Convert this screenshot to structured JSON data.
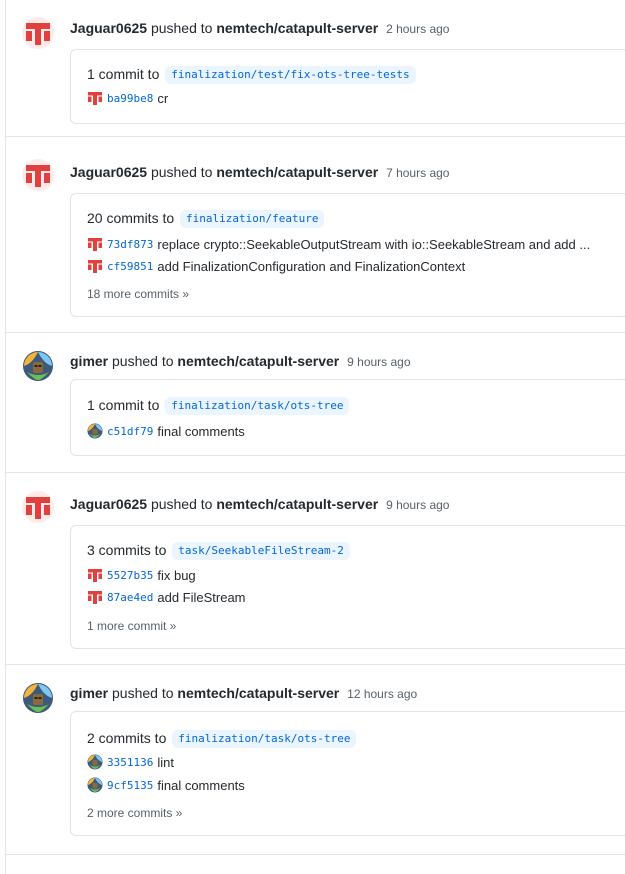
{
  "events": [
    {
      "actor": "Jaguar0625",
      "verb": "pushed to",
      "repo": "nemtech/catapult-server",
      "time": "2 hours ago",
      "avatar": "jaguar-avatar",
      "summary_prefix": "1 commit to",
      "branch": "finalization/test/fix-ots-tree-tests",
      "commits": [
        {
          "sha": "ba99be8",
          "message": "cr",
          "avatar": "jaguar-avatar"
        }
      ],
      "more": ""
    },
    {
      "actor": "Jaguar0625",
      "verb": "pushed to",
      "repo": "nemtech/catapult-server",
      "time": "7 hours ago",
      "avatar": "jaguar-avatar",
      "summary_prefix": "20 commits to",
      "branch": "finalization/feature",
      "commits": [
        {
          "sha": "73df873",
          "message": "replace crypto::SeekableOutputStream with io::SeekableStream and add ...",
          "avatar": "jaguar-avatar"
        },
        {
          "sha": "cf59851",
          "message": "add FinalizationConfiguration and FinalizationContext",
          "avatar": "jaguar-avatar"
        }
      ],
      "more": "18 more commits »"
    },
    {
      "actor": "gimer",
      "verb": "pushed to",
      "repo": "nemtech/catapult-server",
      "time": "9 hours ago",
      "avatar": "gimer-avatar",
      "summary_prefix": "1 commit to",
      "branch": "finalization/task/ots-tree",
      "commits": [
        {
          "sha": "c51df79",
          "message": "final comments",
          "avatar": "gimer-avatar"
        }
      ],
      "more": ""
    },
    {
      "actor": "Jaguar0625",
      "verb": "pushed to",
      "repo": "nemtech/catapult-server",
      "time": "9 hours ago",
      "avatar": "jaguar-avatar",
      "summary_prefix": "3 commits to",
      "branch": "task/SeekableFileStream-2",
      "commits": [
        {
          "sha": "5527b35",
          "message": "fix bug",
          "avatar": "jaguar-avatar"
        },
        {
          "sha": "87ae4ed",
          "message": "add FileStream",
          "avatar": "jaguar-avatar"
        }
      ],
      "more": "1 more commit »"
    },
    {
      "actor": "gimer",
      "verb": "pushed to",
      "repo": "nemtech/catapult-server",
      "time": "12 hours ago",
      "avatar": "gimer-avatar",
      "summary_prefix": "2 commits to",
      "branch": "finalization/task/ots-tree",
      "commits": [
        {
          "sha": "3351136",
          "message": "lint",
          "avatar": "gimer-avatar"
        },
        {
          "sha": "9cf5135",
          "message": "final comments",
          "avatar": "gimer-avatar"
        }
      ],
      "more": "2 more commits »"
    }
  ]
}
